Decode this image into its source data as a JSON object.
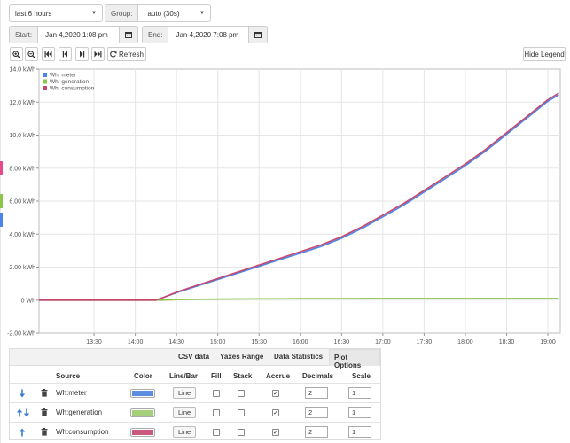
{
  "controls": {
    "range_value": "last 6 hours",
    "group_label": "Group:",
    "group_value": "auto (30s)",
    "start_label": "Start:",
    "start_value": "Jan 4,2020 1:08 pm",
    "end_label": "End:",
    "end_value": "Jan 4,2020 7:08 pm",
    "refresh_label": "Refresh",
    "hide_legend_label": "Hide Legend"
  },
  "side_markers": [
    "#e54b8b",
    "#8cc64a",
    "#4a86e8"
  ],
  "chart_data": {
    "type": "line",
    "x": [
      "12:50",
      "13:00",
      "13:30",
      "14:00",
      "14:15",
      "14:20",
      "14:30",
      "14:45",
      "15:00",
      "15:15",
      "15:30",
      "15:45",
      "16:00",
      "16:15",
      "16:30",
      "16:45",
      "17:00",
      "17:15",
      "17:30",
      "17:45",
      "18:00",
      "18:15",
      "18:30",
      "18:45",
      "19:00",
      "19:08"
    ],
    "x_ticks": [
      "13:30",
      "14:00",
      "14:30",
      "15:00",
      "15:30",
      "16:00",
      "16:30",
      "17:00",
      "17:30",
      "18:00",
      "18:30",
      "19:00"
    ],
    "y_ticks": [
      "-2.00 kWh",
      "0 Wh",
      "2.00 kWh",
      "4.00 kWh",
      "6.00 kWh",
      "8.00 kWh",
      "10.0 kWh",
      "12.0 kWh",
      "14.0 kWh"
    ],
    "ylim": [
      -2,
      14
    ],
    "y_unit": "kWh",
    "grid": true,
    "legend_position": "top-left",
    "series": [
      {
        "name": "Wh: meter",
        "color": "#4a86e8",
        "values": [
          0,
          0,
          0,
          0,
          0,
          0.15,
          0.45,
          0.85,
          1.25,
          1.65,
          2.05,
          2.45,
          2.85,
          3.25,
          3.75,
          4.35,
          5.05,
          5.75,
          6.55,
          7.35,
          8.15,
          9.05,
          10.05,
          11.05,
          12.05,
          12.45
        ]
      },
      {
        "name": "Wh: generation",
        "color": "#8cc64a",
        "values": [
          0,
          0,
          0,
          0,
          0,
          0,
          0.03,
          0.05,
          0.06,
          0.07,
          0.08,
          0.08,
          0.09,
          0.09,
          0.09,
          0.1,
          0.1,
          0.1,
          0.1,
          0.1,
          0.1,
          0.1,
          0.1,
          0.1,
          0.1,
          0.1
        ]
      },
      {
        "name": "Wh: consumption",
        "color": "#c9476b",
        "values": [
          0,
          0,
          0,
          0,
          0,
          0.15,
          0.48,
          0.9,
          1.31,
          1.72,
          2.13,
          2.53,
          2.94,
          3.34,
          3.84,
          4.45,
          5.15,
          5.85,
          6.65,
          7.45,
          8.25,
          9.15,
          10.15,
          11.15,
          12.15,
          12.55
        ]
      }
    ]
  },
  "options_panel": {
    "tabs": [
      "CSV data",
      "Yaxes Range",
      "Data Statistics",
      "Plot Options"
    ],
    "active_tab": "Plot Options",
    "columns": [
      "Source",
      "Color",
      "Line/Bar",
      "Fill",
      "Stack",
      "Accrue",
      "Decimals",
      "Scale"
    ],
    "rows": [
      {
        "source": "Wh:meter",
        "color": "#5b8de0",
        "line_bar": "Line",
        "fill": false,
        "stack": false,
        "accrue": true,
        "decimals": "2",
        "scale": "1",
        "arrows": "down"
      },
      {
        "source": "Wh:generation",
        "color": "#a5cf79",
        "line_bar": "Line",
        "fill": false,
        "stack": false,
        "accrue": true,
        "decimals": "2",
        "scale": "1",
        "arrows": "updown"
      },
      {
        "source": "Wh:consumption",
        "color": "#c95a7c",
        "line_bar": "Line",
        "fill": false,
        "stack": false,
        "accrue": true,
        "decimals": "2",
        "scale": "1",
        "arrows": "up"
      }
    ]
  }
}
